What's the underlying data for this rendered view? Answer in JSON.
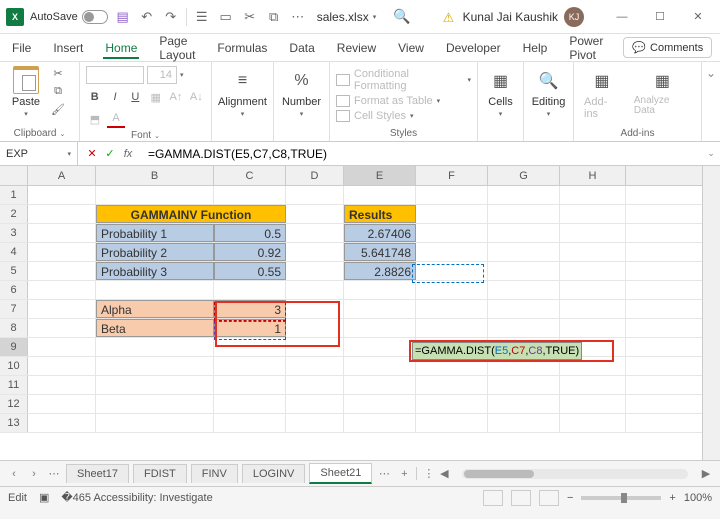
{
  "title": {
    "autosave": "AutoSave",
    "filename": "sales.xlsx",
    "user": "Kunal Jai Kaushik",
    "initials": "KJ"
  },
  "menu": {
    "file": "File",
    "insert": "Insert",
    "home": "Home",
    "page_layout": "Page Layout",
    "formulas": "Formulas",
    "data": "Data",
    "review": "Review",
    "view": "View",
    "developer": "Developer",
    "help": "Help",
    "power_pivot": "Power Pivot",
    "comments": "Comments"
  },
  "ribbon": {
    "clipboard": {
      "paste": "Paste",
      "label": "Clipboard"
    },
    "font": {
      "size": "14",
      "bold": "B",
      "italic": "I",
      "underline": "U",
      "label": "Font"
    },
    "alignment": "Alignment",
    "number": "Number",
    "styles": {
      "cond": "Conditional Formatting",
      "table": "Format as Table",
      "cell": "Cell Styles",
      "label": "Styles"
    },
    "cells": "Cells",
    "editing": "Editing",
    "addins": {
      "addins": "Add-ins",
      "analyze": "Analyze Data",
      "label": "Add-ins"
    }
  },
  "namebox": "EXP",
  "formula": "=GAMMA.DIST(E5,C7,C8,TRUE)",
  "formula_parts": {
    "prefix": "=GAMMA.DIST(",
    "a1": "E5",
    "a2": "C7",
    "a3": "C8",
    "a4": "TRUE",
    "suffix": ")"
  },
  "columns": [
    "A",
    "B",
    "C",
    "D",
    "E",
    "F",
    "G",
    "H"
  ],
  "rows": [
    "1",
    "2",
    "3",
    "4",
    "5",
    "6",
    "7",
    "8",
    "9",
    "10",
    "11",
    "12",
    "13"
  ],
  "cells": {
    "B2": "GAMMAINV Function",
    "E2": "Results",
    "B3": "Probability 1",
    "C3": "0.5",
    "E3": "2.67406",
    "B4": "Probability 2",
    "C4": "0.92",
    "E4": "5.641748",
    "B5": "Probability 3",
    "C5": "0.55",
    "E5": "2.8826",
    "B7": "Alpha",
    "C7": "3",
    "B8": "Beta",
    "C8": "1"
  },
  "chart_data": {
    "type": "table",
    "title": "GAMMAINV Function",
    "inputs": [
      {
        "label": "Probability 1",
        "value": 0.5,
        "result": 2.67406
      },
      {
        "label": "Probability 2",
        "value": 0.92,
        "result": 5.641748
      },
      {
        "label": "Probability 3",
        "value": 0.55,
        "result": 2.8826
      }
    ],
    "parameters": {
      "Alpha": 3,
      "Beta": 1
    },
    "active_formula": "=GAMMA.DIST(E5,C7,C8,TRUE)"
  },
  "tabs": {
    "s1": "Sheet17",
    "s2": "FDIST",
    "s3": "FINV",
    "s4": "LOGINV",
    "s5": "Sheet21"
  },
  "status": {
    "mode": "Edit",
    "acc": "Accessibility: Investigate",
    "zoom": "100%"
  }
}
